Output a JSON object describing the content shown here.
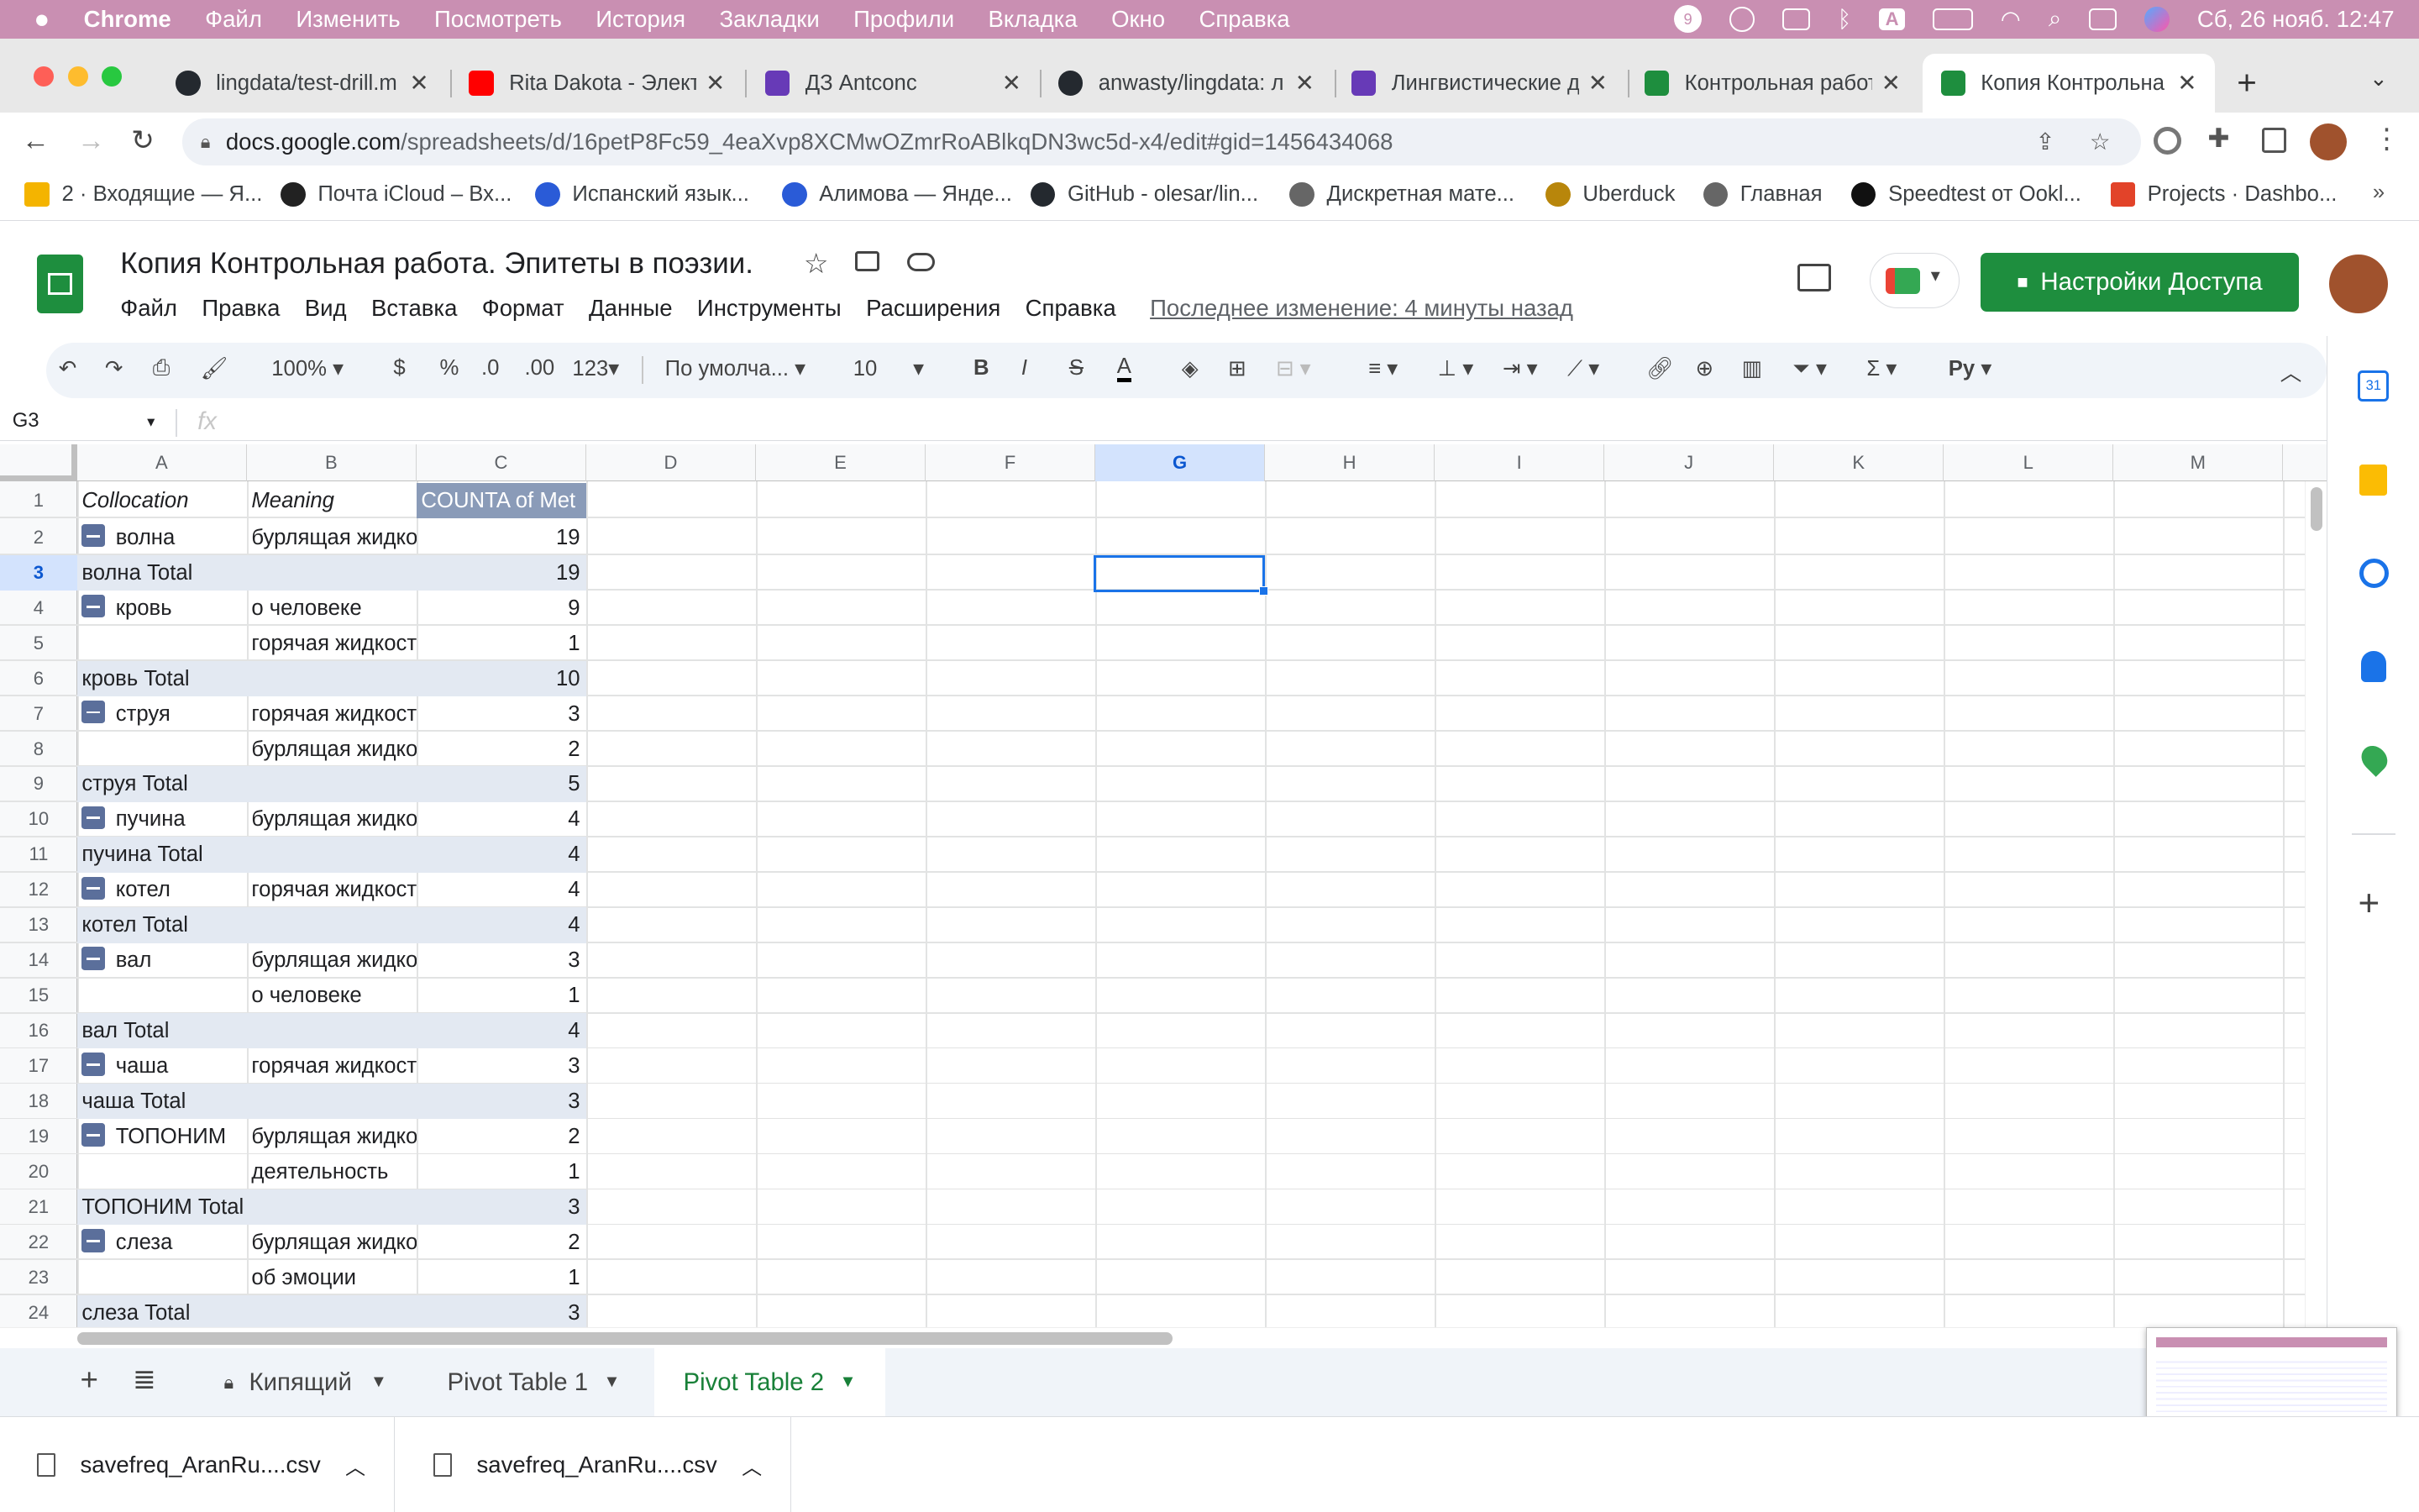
{
  "macos_menubar": {
    "app": "Chrome",
    "items": [
      "Файл",
      "Изменить",
      "Посмотреть",
      "История",
      "Закладки",
      "Профили",
      "Вкладка",
      "Окно",
      "Справка"
    ],
    "clock": "Сб, 26 нояб. 12:47",
    "badge": "9"
  },
  "browser": {
    "tabs": [
      {
        "title": "lingdata/test-drill.m",
        "favicon": "github-icon"
      },
      {
        "title": "Rita Dakota - Элект",
        "favicon": "youtube-icon"
      },
      {
        "title": "ДЗ Antconc",
        "favicon": "forms-icon"
      },
      {
        "title": "anwasty/lingdata: л",
        "favicon": "github-icon"
      },
      {
        "title": "Лингвистические д",
        "favicon": "forms-icon"
      },
      {
        "title": "Контрольная работ",
        "favicon": "sheets-icon"
      },
      {
        "title": "Копия Контрольна",
        "favicon": "sheets-icon"
      }
    ],
    "url_host": "docs.google.com",
    "url_path": "/spreadsheets/d/16petP8Fc59_4eaXvp8XCMwOZmrRoABlkqDN3wc5d-x4/edit#gid=1456434068",
    "bookmarks": [
      "2 · Входящие — Я...",
      "Почта iCloud – Вх...",
      "Испанский язык...",
      "Алимова — Янде...",
      "GitHub - olesar/lin...",
      "Дискретная мате...",
      "Uberduck",
      "Главная",
      "Speedtest от Ookl...",
      "Projects · Dashbo..."
    ]
  },
  "sheets": {
    "title": "Копия Контрольная работа. Эпитеты в поэзии.",
    "menu": [
      "Файл",
      "Правка",
      "Вид",
      "Вставка",
      "Формат",
      "Данные",
      "Инструменты",
      "Расширения",
      "Справка"
    ],
    "last_edit": "Последнее изменение: 4 минуты назад",
    "share": "Настройки Доступа",
    "toolbar": {
      "zoom": "100%",
      "currency": "$",
      "percent": "%",
      "dec_less": ".0",
      "dec_more": ".00",
      "num_format": "123",
      "font": "По умолча...",
      "size": "10",
      "bold": "B",
      "italic": "I",
      "strike": "S",
      "textcolor": "A",
      "input_tools": "Pу"
    },
    "name_box": "G3",
    "fx": "fx",
    "columns": [
      "A",
      "B",
      "C",
      "D",
      "E",
      "F",
      "G",
      "H",
      "I",
      "J",
      "K",
      "L",
      "M"
    ],
    "header_row": [
      "Collocation",
      "Meaning",
      "COUNTA of Met"
    ],
    "rows": [
      {
        "n": "1",
        "type": "head"
      },
      {
        "n": "2",
        "a": "волна",
        "b": "бурлящая жидкость",
        "c": "19",
        "minus": true
      },
      {
        "n": "3",
        "a": "волна Total",
        "b": "",
        "c": "19",
        "total": true
      },
      {
        "n": "4",
        "a": "кровь",
        "b": "о человеке",
        "c": "9",
        "minus": true
      },
      {
        "n": "5",
        "a": "",
        "b": "горячая жидкость",
        "c": "1"
      },
      {
        "n": "6",
        "a": "кровь Total",
        "b": "",
        "c": "10",
        "total": true
      },
      {
        "n": "7",
        "a": "струя",
        "b": "горячая жидкость",
        "c": "3",
        "minus": true
      },
      {
        "n": "8",
        "a": "",
        "b": "бурлящая жидкость",
        "c": "2"
      },
      {
        "n": "9",
        "a": "струя Total",
        "b": "",
        "c": "5",
        "total": true
      },
      {
        "n": "10",
        "a": "пучина",
        "b": "бурлящая жидкость",
        "c": "4",
        "minus": true
      },
      {
        "n": "11",
        "a": "пучина Total",
        "b": "",
        "c": "4",
        "total": true
      },
      {
        "n": "12",
        "a": "котел",
        "b": "горячая жидкость",
        "c": "4",
        "minus": true
      },
      {
        "n": "13",
        "a": "котел Total",
        "b": "",
        "c": "4",
        "total": true
      },
      {
        "n": "14",
        "a": "вал",
        "b": "бурлящая жидкость",
        "c": "3",
        "minus": true
      },
      {
        "n": "15",
        "a": "",
        "b": "о человеке",
        "c": "1"
      },
      {
        "n": "16",
        "a": "вал Total",
        "b": "",
        "c": "4",
        "total": true
      },
      {
        "n": "17",
        "a": "чаша",
        "b": "горячая жидкость",
        "c": "3",
        "minus": true
      },
      {
        "n": "18",
        "a": "чаша Total",
        "b": "",
        "c": "3",
        "total": true
      },
      {
        "n": "19",
        "a": "ТОПОНИМ",
        "b": "бурлящая жидкость",
        "c": "2",
        "minus": true
      },
      {
        "n": "20",
        "a": "",
        "b": "деятельность",
        "c": "1"
      },
      {
        "n": "21",
        "a": "ТОПОНИМ Total",
        "b": "",
        "c": "3",
        "total": true
      },
      {
        "n": "22",
        "a": "слеза",
        "b": "бурлящая жидкость",
        "c": "2",
        "minus": true
      },
      {
        "n": "23",
        "a": "",
        "b": "об эмоции",
        "c": "1"
      },
      {
        "n": "24",
        "a": "слеза Total",
        "b": "",
        "c": "3",
        "total": true
      }
    ],
    "sheet_tabs": [
      "Кипящий",
      "Pivot Table 1",
      "Pivot Table 2"
    ],
    "active_sheet": "Pivot Table 2"
  },
  "downloads": [
    "savefreq_AranRu....csv",
    "savefreq_AranRu....csv"
  ],
  "colors": {
    "menubar": "#c98fb2",
    "pivot_header": "#8a9bb8",
    "total_row": "#e3e9f2",
    "accent": "#1e8e3e",
    "sheet_tab": "#188038"
  }
}
